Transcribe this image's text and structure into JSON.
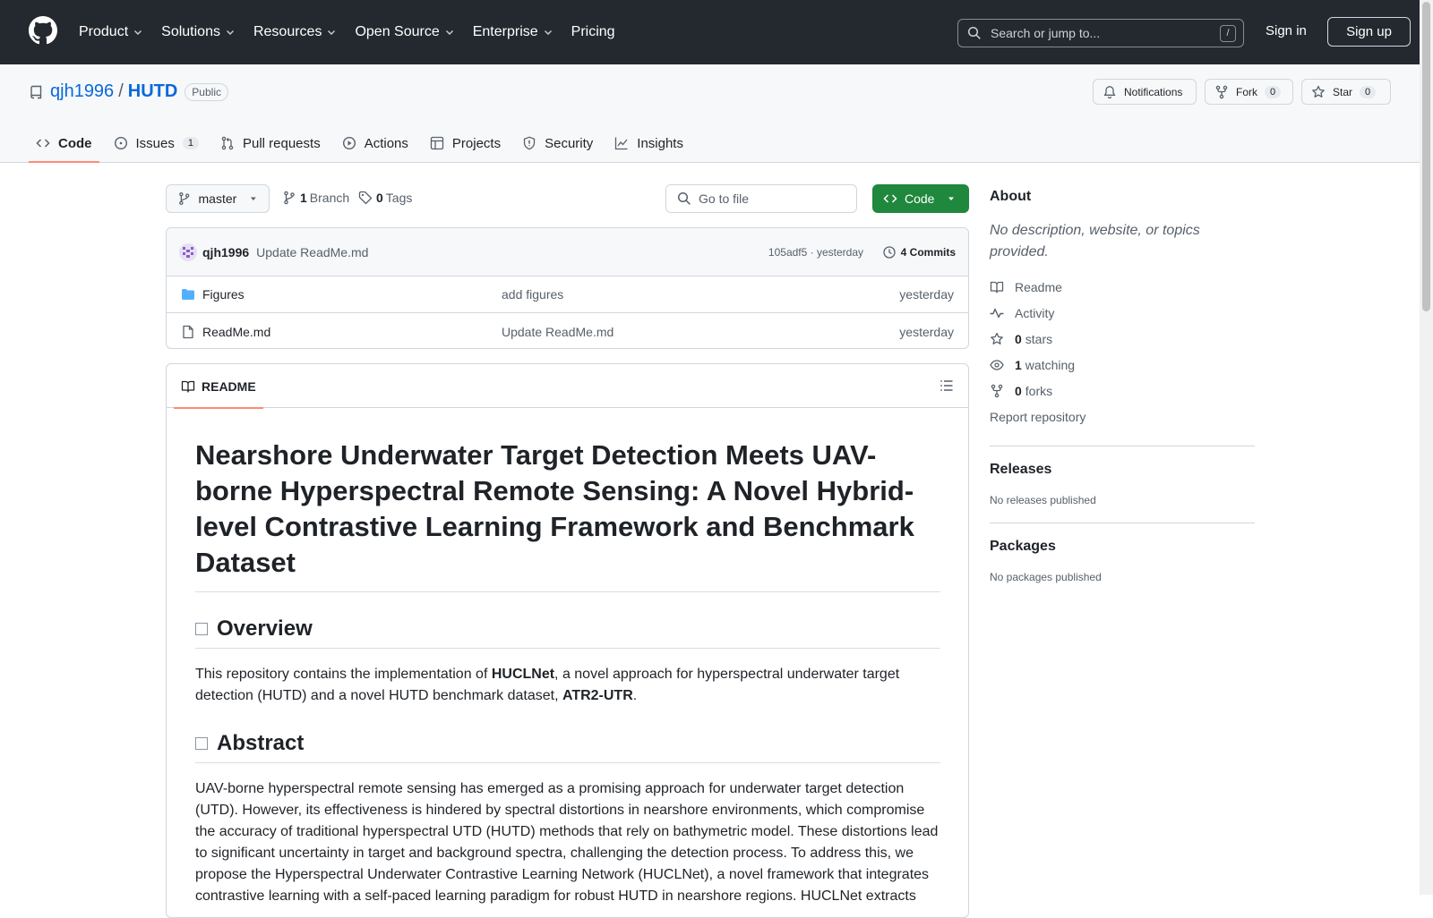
{
  "nav": {
    "items": [
      "Product",
      "Solutions",
      "Resources",
      "Open Source",
      "Enterprise",
      "Pricing"
    ],
    "search_placeholder": "Search or jump to...",
    "search_key": "/",
    "sign_in": "Sign in",
    "sign_up": "Sign up"
  },
  "repo": {
    "owner": "qjh1996",
    "separator": "/",
    "name": "HUTD",
    "visibility": "Public",
    "notifications_label": "Notifications",
    "fork_label": "Fork",
    "fork_count": "0",
    "star_label": "Star",
    "star_count": "0"
  },
  "tabs": [
    {
      "label": "Code"
    },
    {
      "label": "Issues",
      "count": "1"
    },
    {
      "label": "Pull requests"
    },
    {
      "label": "Actions"
    },
    {
      "label": "Projects"
    },
    {
      "label": "Security"
    },
    {
      "label": "Insights"
    }
  ],
  "branchbar": {
    "branch": "master",
    "branch_count": "1",
    "branch_label": "Branch",
    "tag_count": "0",
    "tag_label": "Tags",
    "goto_placeholder": "Go to file",
    "code_button": "Code"
  },
  "commit": {
    "author": "qjh1996",
    "message": "Update ReadMe.md",
    "hash_time": "105adf5 · yesterday",
    "commits_label": "4 Commits"
  },
  "files": [
    {
      "name": "Figures",
      "message": "add figures",
      "time": "yesterday",
      "type": "folder"
    },
    {
      "name": "ReadMe.md",
      "message": "Update ReadMe.md",
      "time": "yesterday",
      "type": "file"
    }
  ],
  "readme": {
    "tab_label": "README",
    "title": "Nearshore Underwater Target Detection Meets UAV-borne Hyperspectral Remote Sensing: A Novel Hybrid-level Contrastive Learning Framework and Benchmark Dataset",
    "overview_heading": "Overview",
    "overview_pre": "This repository contains the implementation of ",
    "overview_bold1": "HUCLNet",
    "overview_mid": ", a novel approach for hyperspectral underwater target detection (HUTD) and a novel HUTD benchmark dataset, ",
    "overview_bold2": "ATR2-UTR",
    "overview_post": ".",
    "abstract_heading": "Abstract",
    "abstract_text": "UAV-borne hyperspectral remote sensing has emerged as a promising approach for underwater target detection (UTD). However, its effectiveness is hindered by spectral distortions in nearshore environments, which compromise the accuracy of traditional hyperspectral UTD (HUTD) methods that rely on bathymetric model. These distortions lead to significant uncertainty in target and background spectra, challenging the detection process. To address this, we propose the Hyperspectral Underwater Contrastive Learning Network (HUCLNet), a novel framework that integrates contrastive learning with a self-paced learning paradigm for robust HUTD in nearshore regions. HUCLNet extracts"
  },
  "about": {
    "heading": "About",
    "description": "No description, website, or topics provided.",
    "readme": "Readme",
    "activity": "Activity",
    "stars_count": "0",
    "stars_label": "stars",
    "watching_count": "1",
    "watching_label": "watching",
    "forks_count": "0",
    "forks_label": "forks",
    "report": "Report repository"
  },
  "releases": {
    "heading": "Releases",
    "text": "No releases published"
  },
  "packages": {
    "heading": "Packages",
    "text": "No packages published"
  }
}
